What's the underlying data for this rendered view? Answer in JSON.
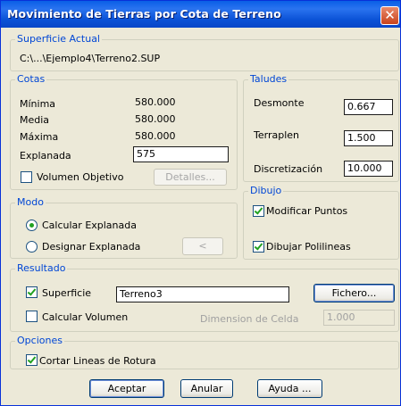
{
  "window": {
    "title": "Movimiento de Tierras por Cota de Terreno",
    "close_glyph": "✕"
  },
  "superficie": {
    "legend": "Superficie Actual",
    "path": "C:\\...\\Ejemplo4\\Terreno2.SUP"
  },
  "cotas": {
    "legend": "Cotas",
    "minima_label": "Mínima",
    "minima_value": "580.000",
    "media_label": "Media",
    "media_value": "580.000",
    "maxima_label": "Máxima",
    "maxima_value": "580.000",
    "explanada_label": "Explanada",
    "explanada_value": "575",
    "volumen_label": "Volumen Objetivo",
    "volumen_checked": false,
    "detalles_label": "Detalles..."
  },
  "taludes": {
    "legend": "Taludes",
    "desmonte_label": "Desmonte",
    "desmonte_value": "0.667",
    "terraplen_label": "Terraplen",
    "terraplen_value": "1.500",
    "discretizacion_label": "Discretización",
    "discretizacion_value": "10.000"
  },
  "modo": {
    "legend": "Modo",
    "calcular_label": "Calcular Explanada",
    "calcular_selected": true,
    "designar_label": "Designar Explanada",
    "designar_selected": false,
    "pick_label": "<"
  },
  "dibujo": {
    "legend": "Dibujo",
    "modificar_label": "Modificar Puntos",
    "modificar_checked": true,
    "polilineas_label": "Dibujar Polilineas",
    "polilineas_checked": true
  },
  "resultado": {
    "legend": "Resultado",
    "superficie_label": "Superficie",
    "superficie_checked": true,
    "superficie_value": "Terreno3",
    "fichero_label": "Fichero...",
    "calcular_volumen_label": "Calcular Volumen",
    "calcular_volumen_checked": false,
    "celda_label": "Dimension de Celda",
    "celda_value": "1.000"
  },
  "opciones": {
    "legend": "Opciones",
    "cortar_label": "Cortar Lineas de Rotura",
    "cortar_checked": true
  },
  "buttons": {
    "aceptar": "Aceptar",
    "anular": "Anular",
    "ayuda": "Ayuda ..."
  },
  "colors": {
    "titlebar": "#0a5fe6",
    "legend_text": "#0046d5",
    "dialog_bg": "#ece9d8",
    "check": "#21a121"
  }
}
